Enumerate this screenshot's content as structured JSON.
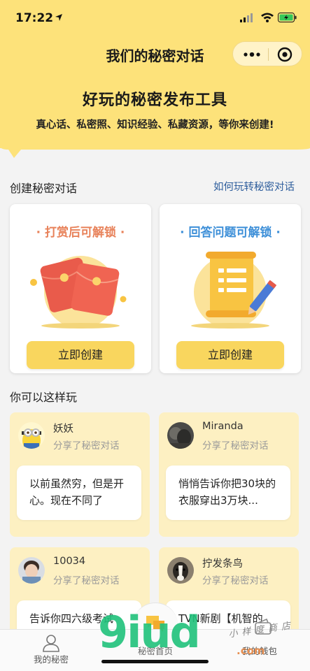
{
  "status_bar": {
    "time": "17:22"
  },
  "nav": {
    "title": "我们的秘密对话"
  },
  "hero": {
    "title": "好玩的秘密发布工具",
    "subtitle": "真心话、私密照、知识经验、私藏资源，等你来创建!"
  },
  "create_section": {
    "title": "创建秘密对话",
    "link": "如何玩转秘密对话",
    "cards": [
      {
        "heading": "· 打赏后可解锁 ·",
        "button": "立即创建"
      },
      {
        "heading": "· 回答问题可解锁 ·",
        "button": "立即创建"
      }
    ]
  },
  "examples_section": {
    "title": "你可以这样玩",
    "items": [
      {
        "name": "妖妖",
        "action": "分享了秘密对话",
        "text": "以前虽然穷，但是开心。现在不同了"
      },
      {
        "name": "Miranda",
        "action": "分享了秘密对话",
        "text": "悄悄告诉你把30块的衣服穿出3万块..."
      },
      {
        "name": "10034",
        "action": "分享了秘密对话",
        "text": "告诉你四六级考试"
      },
      {
        "name": "拧发条鸟",
        "action": "分享了秘密对话",
        "text": "TVN新剧【机智的"
      }
    ]
  },
  "tabbar": {
    "tabs": [
      {
        "label": "我的秘密"
      },
      {
        "label": "秘密首页"
      },
      {
        "label": "我的钱包"
      }
    ]
  },
  "watermark": {
    "logo": "9iud",
    "domain": ".com",
    "store": "小样度商店"
  },
  "colors": {
    "header_bg": "#fde27a",
    "button": "#f9d65e",
    "example_card": "#fdf0c2",
    "link": "#2d5d9c",
    "orange_heading": "#e8825a",
    "blue_heading": "#3d8fd8"
  }
}
